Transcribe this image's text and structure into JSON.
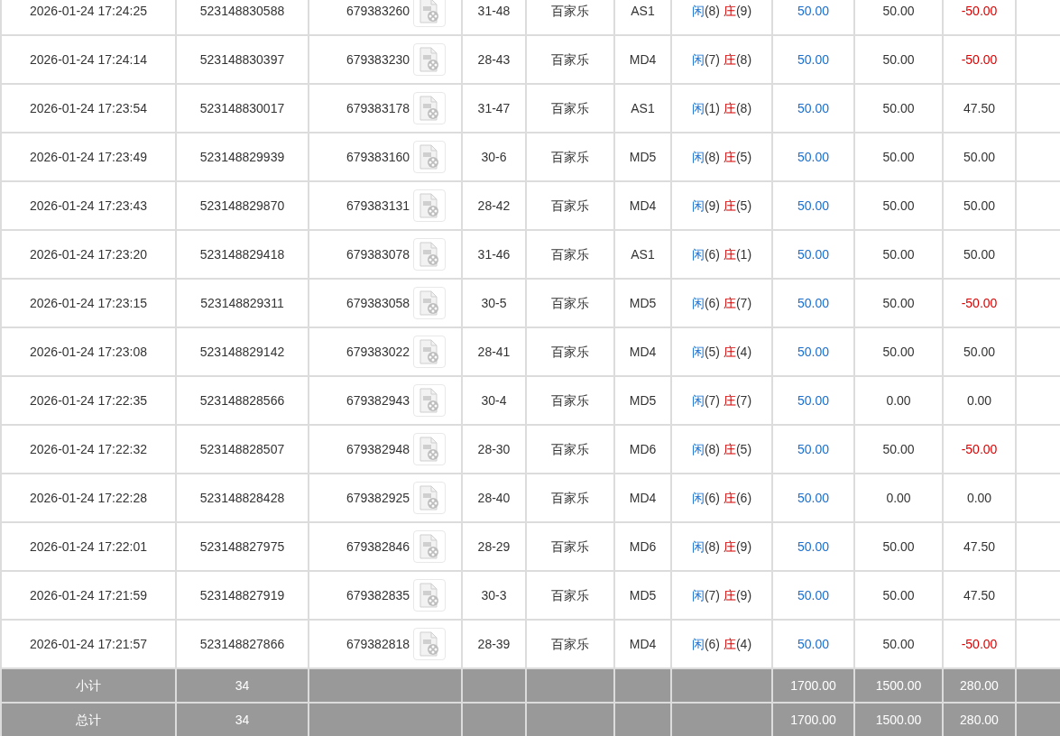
{
  "rows": [
    {
      "time": "2026-01-24 17:24:25",
      "order_no": "523148830588",
      "round_no": "679383260",
      "table": "31-48",
      "game": "百家乐",
      "hall": "AS1",
      "result": {
        "player_label": "闲",
        "player_score": "(8)",
        "banker_label": "庄",
        "banker_score": "(9)"
      },
      "bet": "50.00",
      "valid_bet": "50.00",
      "win_loss": "-50.00",
      "loss": true
    },
    {
      "time": "2026-01-24 17:24:14",
      "order_no": "523148830397",
      "round_no": "679383230",
      "table": "28-43",
      "game": "百家乐",
      "hall": "MD4",
      "result": {
        "player_label": "闲",
        "player_score": "(7)",
        "banker_label": "庄",
        "banker_score": "(8)"
      },
      "bet": "50.00",
      "valid_bet": "50.00",
      "win_loss": "-50.00",
      "loss": true
    },
    {
      "time": "2026-01-24 17:23:54",
      "order_no": "523148830017",
      "round_no": "679383178",
      "table": "31-47",
      "game": "百家乐",
      "hall": "AS1",
      "result": {
        "player_label": "闲",
        "player_score": "(1)",
        "banker_label": "庄",
        "banker_score": "(8)"
      },
      "bet": "50.00",
      "valid_bet": "50.00",
      "win_loss": "47.50",
      "loss": false
    },
    {
      "time": "2026-01-24 17:23:49",
      "order_no": "523148829939",
      "round_no": "679383160",
      "table": "30-6",
      "game": "百家乐",
      "hall": "MD5",
      "result": {
        "player_label": "闲",
        "player_score": "(8)",
        "banker_label": "庄",
        "banker_score": "(5)"
      },
      "bet": "50.00",
      "valid_bet": "50.00",
      "win_loss": "50.00",
      "loss": false
    },
    {
      "time": "2026-01-24 17:23:43",
      "order_no": "523148829870",
      "round_no": "679383131",
      "table": "28-42",
      "game": "百家乐",
      "hall": "MD4",
      "result": {
        "player_label": "闲",
        "player_score": "(9)",
        "banker_label": "庄",
        "banker_score": "(5)"
      },
      "bet": "50.00",
      "valid_bet": "50.00",
      "win_loss": "50.00",
      "loss": false
    },
    {
      "time": "2026-01-24 17:23:20",
      "order_no": "523148829418",
      "round_no": "679383078",
      "table": "31-46",
      "game": "百家乐",
      "hall": "AS1",
      "result": {
        "player_label": "闲",
        "player_score": "(6)",
        "banker_label": "庄",
        "banker_score": "(1)"
      },
      "bet": "50.00",
      "valid_bet": "50.00",
      "win_loss": "50.00",
      "loss": false
    },
    {
      "time": "2026-01-24 17:23:15",
      "order_no": "523148829311",
      "round_no": "679383058",
      "table": "30-5",
      "game": "百家乐",
      "hall": "MD5",
      "result": {
        "player_label": "闲",
        "player_score": "(6)",
        "banker_label": "庄",
        "banker_score": "(7)"
      },
      "bet": "50.00",
      "valid_bet": "50.00",
      "win_loss": "-50.00",
      "loss": true
    },
    {
      "time": "2026-01-24 17:23:08",
      "order_no": "523148829142",
      "round_no": "679383022",
      "table": "28-41",
      "game": "百家乐",
      "hall": "MD4",
      "result": {
        "player_label": "闲",
        "player_score": "(5)",
        "banker_label": "庄",
        "banker_score": "(4)"
      },
      "bet": "50.00",
      "valid_bet": "50.00",
      "win_loss": "50.00",
      "loss": false
    },
    {
      "time": "2026-01-24 17:22:35",
      "order_no": "523148828566",
      "round_no": "679382943",
      "table": "30-4",
      "game": "百家乐",
      "hall": "MD5",
      "result": {
        "player_label": "闲",
        "player_score": "(7)",
        "banker_label": "庄",
        "banker_score": "(7)"
      },
      "bet": "50.00",
      "valid_bet": "0.00",
      "win_loss": "0.00",
      "loss": false
    },
    {
      "time": "2026-01-24 17:22:32",
      "order_no": "523148828507",
      "round_no": "679382948",
      "table": "28-30",
      "game": "百家乐",
      "hall": "MD6",
      "result": {
        "player_label": "闲",
        "player_score": "(8)",
        "banker_label": "庄",
        "banker_score": "(5)"
      },
      "bet": "50.00",
      "valid_bet": "50.00",
      "win_loss": "-50.00",
      "loss": true
    },
    {
      "time": "2026-01-24 17:22:28",
      "order_no": "523148828428",
      "round_no": "679382925",
      "table": "28-40",
      "game": "百家乐",
      "hall": "MD4",
      "result": {
        "player_label": "闲",
        "player_score": "(6)",
        "banker_label": "庄",
        "banker_score": "(6)"
      },
      "bet": "50.00",
      "valid_bet": "0.00",
      "win_loss": "0.00",
      "loss": false
    },
    {
      "time": "2026-01-24 17:22:01",
      "order_no": "523148827975",
      "round_no": "679382846",
      "table": "28-29",
      "game": "百家乐",
      "hall": "MD6",
      "result": {
        "player_label": "闲",
        "player_score": "(8)",
        "banker_label": "庄",
        "banker_score": "(9)"
      },
      "bet": "50.00",
      "valid_bet": "50.00",
      "win_loss": "47.50",
      "loss": false
    },
    {
      "time": "2026-01-24 17:21:59",
      "order_no": "523148827919",
      "round_no": "679382835",
      "table": "30-3",
      "game": "百家乐",
      "hall": "MD5",
      "result": {
        "player_label": "闲",
        "player_score": "(7)",
        "banker_label": "庄",
        "banker_score": "(9)"
      },
      "bet": "50.00",
      "valid_bet": "50.00",
      "win_loss": "47.50",
      "loss": false
    },
    {
      "time": "2026-01-24 17:21:57",
      "order_no": "523148827866",
      "round_no": "679382818",
      "table": "28-39",
      "game": "百家乐",
      "hall": "MD4",
      "result": {
        "player_label": "闲",
        "player_score": "(6)",
        "banker_label": "庄",
        "banker_score": "(4)"
      },
      "bet": "50.00",
      "valid_bet": "50.00",
      "win_loss": "-50.00",
      "loss": true
    }
  ],
  "totals": [
    {
      "label": "小计",
      "count": "34",
      "bet": "1700.00",
      "valid_bet": "1500.00",
      "win_loss": "280.00"
    },
    {
      "label": "总计",
      "count": "34",
      "bet": "1700.00",
      "valid_bet": "1500.00",
      "win_loss": "280.00"
    }
  ]
}
